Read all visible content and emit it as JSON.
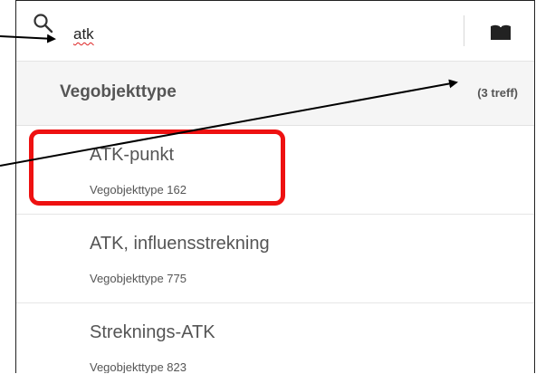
{
  "search": {
    "value": "atk",
    "icon": "search-icon"
  },
  "toolbar": {
    "book_icon": "book-icon"
  },
  "results": {
    "title": "Vegobjekttype",
    "count": "(3 treff)",
    "items": [
      {
        "name": "ATK-punkt",
        "subtitle": "Vegobjekttype 162"
      },
      {
        "name": "ATK, influensstrekning",
        "subtitle": "Vegobjekttype 775"
      },
      {
        "name": "Streknings-ATK",
        "subtitle": "Vegobjekttype 823"
      }
    ]
  },
  "annotations": {
    "highlight_color": "#ee1111",
    "arrow_color": "#000000"
  }
}
